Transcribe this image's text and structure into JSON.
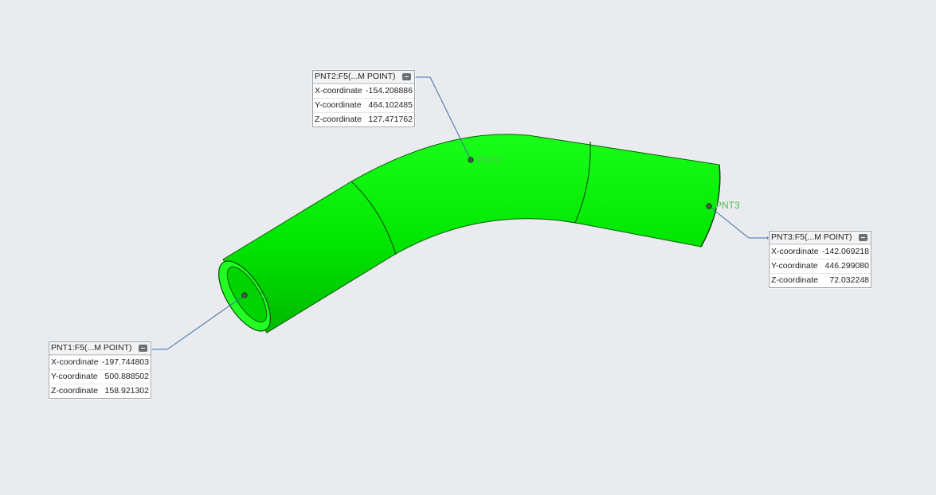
{
  "model": {
    "body_color": "#00f000",
    "background_color": "#e9ebee",
    "leader_color": "#3e6fa8"
  },
  "points": [
    {
      "id": "pnt1",
      "header": "PNT1:F5(...M POINT)",
      "label": "PNT1",
      "rows": [
        {
          "label": "X-coordinate",
          "value": "-197.744803"
        },
        {
          "label": "Y-coordinate",
          "value": "500.888502"
        },
        {
          "label": "Z-coordinate",
          "value": "158.921302"
        }
      ]
    },
    {
      "id": "pnt2",
      "header": "PNT2:F5(...M POINT)",
      "label": "PNT2",
      "rows": [
        {
          "label": "X-coordinate",
          "value": "-154.208886"
        },
        {
          "label": "Y-coordinate",
          "value": "464.102485"
        },
        {
          "label": "Z-coordinate",
          "value": "127.471762"
        }
      ]
    },
    {
      "id": "pnt3",
      "header": "PNT3:F5(...M POINT)",
      "label": "PNT3",
      "rows": [
        {
          "label": "X-coordinate",
          "value": "-142.069218"
        },
        {
          "label": "Y-coordinate",
          "value": "446.299080"
        },
        {
          "label": "Z-coordinate",
          "value": "72.032248"
        }
      ]
    }
  ],
  "icons": {
    "minimize": "minimize-icon",
    "point_marker": "datum-point-icon"
  }
}
